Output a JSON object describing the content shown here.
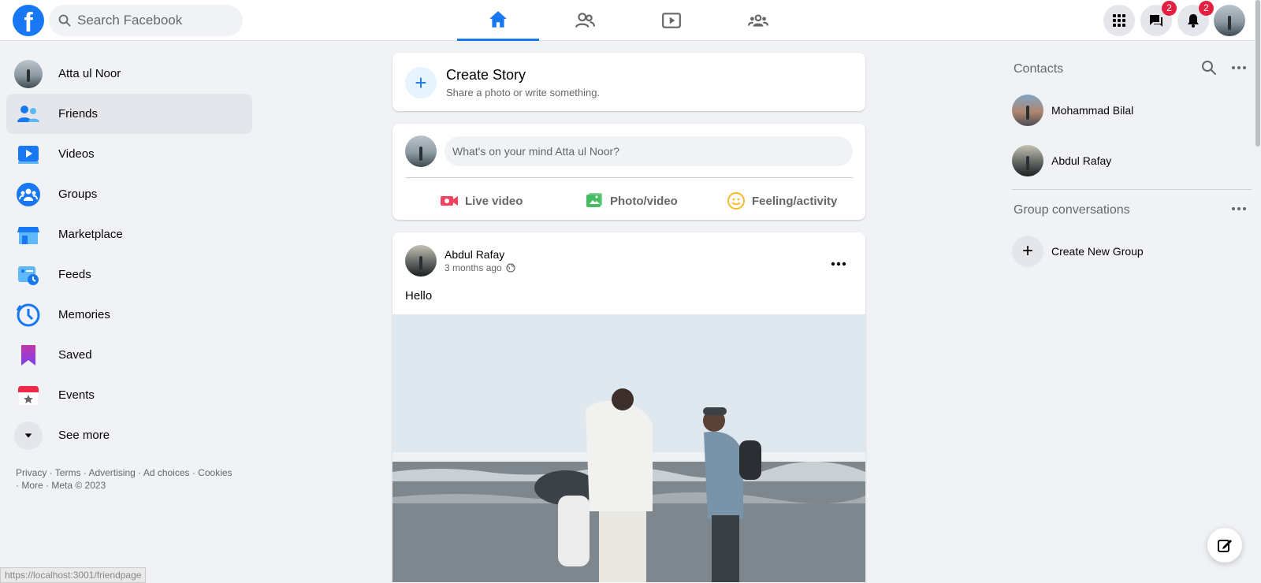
{
  "header": {
    "logo_letter": "f",
    "search_placeholder": "Search Facebook",
    "messenger_badge": "2",
    "notifications_badge": "2",
    "brand_color": "#1877f2"
  },
  "left_sidebar": {
    "profile_name": "Atta ul Noor",
    "items": [
      {
        "label": "Friends",
        "icon": "friends-icon"
      },
      {
        "label": "Videos",
        "icon": "videos-icon"
      },
      {
        "label": "Groups",
        "icon": "groups-icon"
      },
      {
        "label": "Marketplace",
        "icon": "marketplace-icon"
      },
      {
        "label": "Feeds",
        "icon": "feeds-icon"
      },
      {
        "label": "Memories",
        "icon": "memories-icon"
      },
      {
        "label": "Saved",
        "icon": "saved-icon"
      },
      {
        "label": "Events",
        "icon": "events-icon"
      }
    ],
    "see_more": "See more",
    "footer": "Privacy · Terms · Advertising · Ad choices · Cookies · More · Meta © 2023"
  },
  "story": {
    "title": "Create Story",
    "subtitle": "Share a photo or write something."
  },
  "composer": {
    "placeholder": "What's on your mind Atta ul Noor?",
    "actions": [
      "Live video",
      "Photo/video",
      "Feeling/activity"
    ]
  },
  "post": {
    "author": "Abdul Rafay",
    "time": "3 months ago",
    "text": "Hello"
  },
  "right_sidebar": {
    "contacts_title": "Contacts",
    "contacts": [
      "Mohammad Bilal",
      "Abdul Rafay"
    ],
    "group_title": "Group conversations",
    "create_group": "Create New Group"
  },
  "status_url": "https://localhost:3001/friendpage"
}
